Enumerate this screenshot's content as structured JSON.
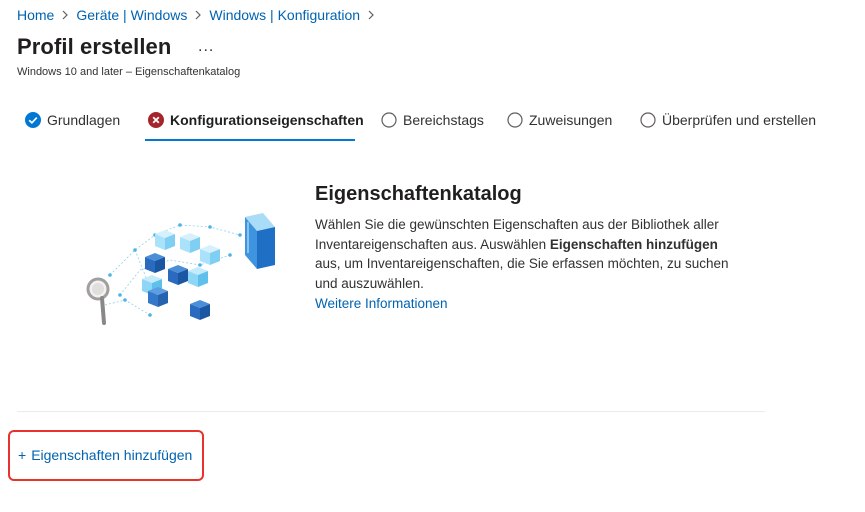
{
  "breadcrumb": {
    "items": [
      "Home",
      "Geräte | Windows",
      "Windows | Konfiguration"
    ]
  },
  "page": {
    "title": "Profil erstellen",
    "more_label": "...",
    "subtitle": "Windows 10 and later – Eigenschaftenkatalog"
  },
  "tabs": [
    {
      "label": "Grundlagen",
      "state": "complete"
    },
    {
      "label": "Konfigurationseigenschaften",
      "state": "error-active"
    },
    {
      "label": "Bereichstags",
      "state": "pending"
    },
    {
      "label": "Zuweisungen",
      "state": "pending"
    },
    {
      "label": "Überprüfen und erstellen",
      "state": "pending"
    }
  ],
  "info": {
    "title": "Eigenschaftenkatalog",
    "text_before": "Wählen Sie die gewünschten Eigenschaften aus der Bibliothek aller Inventareigenschaften aus. Auswählen ",
    "text_bold": "Eigenschaften hinzufügen",
    "text_after": " aus, um Inventareigenschaften, die Sie erfassen möchten, zu suchen und auszuwählen.",
    "link": "Weitere Informationen"
  },
  "actions": {
    "add_plus": "+",
    "add_label": "Eigenschaften hinzufügen"
  },
  "colors": {
    "link": "#0063b1",
    "accent": "#0078d4",
    "error": "#a4262c",
    "highlight": "#e8322e"
  }
}
